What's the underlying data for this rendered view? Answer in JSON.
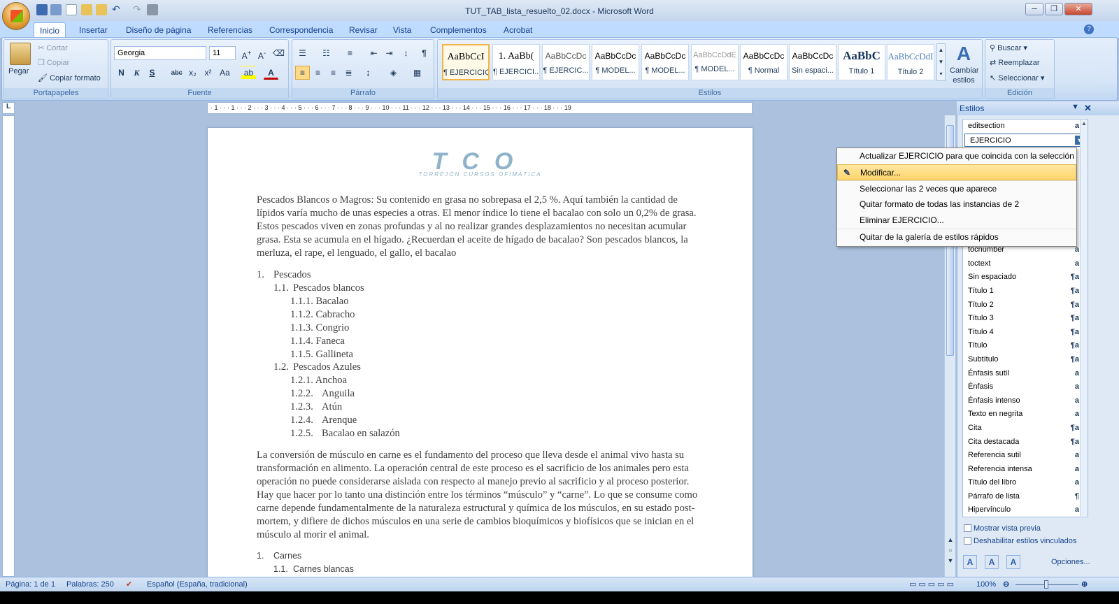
{
  "window": {
    "title": "TUT_TAB_lista_resuelto_02.docx - Microsoft Word",
    "controls": [
      "─",
      "❐",
      "✕"
    ]
  },
  "tabs": [
    "Inicio",
    "Insertar",
    "Diseño de página",
    "Referencias",
    "Correspondencia",
    "Revisar",
    "Vista",
    "Complementos",
    "Acrobat"
  ],
  "ribbon": {
    "portapapeles": {
      "label": "Portapapeles",
      "pegar": "Pegar",
      "cortar": "Cortar",
      "copiar": "Copiar",
      "copiar_formato": "Copiar formato"
    },
    "fuente": {
      "label": "Fuente",
      "font": "Georgia",
      "size": "11"
    },
    "parrafo": {
      "label": "Párrafo"
    },
    "estilos": {
      "label": "Estilos",
      "cambiar": "Cambiar estilos",
      "tiles": [
        {
          "preview": "AaBbCcI",
          "name": "¶ EJERCICIO"
        },
        {
          "preview": "1. AaBb(",
          "name": "¶ EJERCICI..."
        },
        {
          "preview": "AaBbCcDc",
          "name": "¶ EJERCIC..."
        },
        {
          "preview": "AaBbCcDc",
          "name": "¶ MODEL..."
        },
        {
          "preview": "AaBbCcDc",
          "name": "¶ MODEL..."
        },
        {
          "preview": "AaBbCcDdE",
          "name": "¶ MODEL..."
        },
        {
          "preview": "AaBbCcDc",
          "name": "¶ Normal"
        },
        {
          "preview": "AaBbCcDc",
          "name": "Sin espaci..."
        },
        {
          "preview": "AaBbC",
          "name": "Título 1"
        },
        {
          "preview": "AaBbCcDdI",
          "name": "Título 2"
        }
      ]
    },
    "edicion": {
      "label": "Edición",
      "buscar": "Buscar",
      "reemplazar": "Reemplazar",
      "seleccionar": "Seleccionar"
    }
  },
  "document": {
    "logo_big": "TCO",
    "logo_small": "TORREJÓN CURSOS OFIMÁTICA",
    "para1": "Pescados Blancos o Magros: Su contenido en grasa no sobrepasa el 2,5 %. Aquí también la cantidad de lípidos varía mucho de unas especies a otras. El menor índice lo tiene el bacalao con solo un 0,2% de grasa. Estos pescados viven en zonas profundas y al no realizar grandes desplazamientos no necesitan acumular grasa. Esta se acumula en el hígado. ¿Recuerdan el aceite de hígado de bacalao? Son pescados blancos, la merluza, el rape, el lenguado, el gallo, el bacalao",
    "list1": [
      {
        "num": "1.",
        "text": "Pescados"
      },
      {
        "num": "1.1.",
        "text": "Pescados blancos"
      },
      {
        "num": "1.1.1.",
        "text": "Bacalao"
      },
      {
        "num": "1.1.2.",
        "text": "Cabracho"
      },
      {
        "num": "1.1.3.",
        "text": "Congrio"
      },
      {
        "num": "1.1.4.",
        "text": "Faneca"
      },
      {
        "num": "1.1.5.",
        "text": "Gallineta"
      },
      {
        "num": "1.2.",
        "text": "Pescados Azules"
      },
      {
        "num": "1.2.1.",
        "text": "Anchoa"
      },
      {
        "num": "1.2.2.",
        "text": "Anguila"
      },
      {
        "num": "1.2.3.",
        "text": "Atún"
      },
      {
        "num": "1.2.4.",
        "text": "Arenque"
      },
      {
        "num": "1.2.5.",
        "text": "Bacalao en salazón"
      }
    ],
    "para2": "La conversión de músculo en carne es el fundamento del proceso que lleva desde el animal vivo hasta su transformación en alimento. La operación central de este proceso es el sacrificio de los animales pero esta operación no puede considerarse aislada con respecto al manejo previo al sacrificio y al proceso posterior. Hay que hacer por lo tanto una distinción entre los términos “músculo” y “carne”. Lo que se consume como carne depende fundamentalmente de la naturaleza estructural y química de los músculos, en su estado post-mortem, y difiere de dichos músculos en una serie de cambios bioquímicos y biofísicos que se inician en el músculo al morir el animal.",
    "list2": [
      {
        "num": "1.",
        "text": "Carnes"
      },
      {
        "num": "1.1.",
        "text": "Carnes blancas"
      }
    ]
  },
  "styles_pane": {
    "title": "Estilos",
    "items": [
      {
        "name": "editsection",
        "icon": "a"
      },
      {
        "name": "EJERCICIO",
        "icon": "▾"
      },
      {
        "name": "tocnumber",
        "icon": "a"
      },
      {
        "name": "toctext",
        "icon": "a"
      },
      {
        "name": "Sin espaciado",
        "icon": "¶a"
      },
      {
        "name": "Título 1",
        "icon": "¶a"
      },
      {
        "name": "Título 2",
        "icon": "¶a"
      },
      {
        "name": "Título 3",
        "icon": "¶a"
      },
      {
        "name": "Título 4",
        "icon": "¶a"
      },
      {
        "name": "Título",
        "icon": "¶a"
      },
      {
        "name": "Subtítulo",
        "icon": "¶a"
      },
      {
        "name": "Énfasis sutil",
        "icon": "a"
      },
      {
        "name": "Énfasis",
        "icon": "a"
      },
      {
        "name": "Énfasis intenso",
        "icon": "a"
      },
      {
        "name": "Texto en negrita",
        "icon": "a"
      },
      {
        "name": "Cita",
        "icon": "¶a"
      },
      {
        "name": "Cita destacada",
        "icon": "¶a"
      },
      {
        "name": "Referencia sutil",
        "icon": "a"
      },
      {
        "name": "Referencia intensa",
        "icon": "a"
      },
      {
        "name": "Título del libro",
        "icon": "a"
      },
      {
        "name": "Párrafo de lista",
        "icon": "¶"
      },
      {
        "name": "Hipervínculo",
        "icon": "a"
      }
    ],
    "mostrar_vista_previa": "Mostrar vista previa",
    "deshabilitar_vinculados": "Deshabilitar estilos vinculados",
    "opciones": "Opciones..."
  },
  "context_menu": [
    "Actualizar EJERCICIO para que coincida con la selección",
    "Modificar...",
    "Seleccionar las 2 veces que aparece",
    "Quitar formato de todas las instancias de 2",
    "Eliminar EJERCICIO...",
    "Quitar de la galería de estilos rápidos"
  ],
  "status": {
    "pagina": "Página: 1 de 1",
    "palabras": "Palabras: 250",
    "idioma": "Español (España, tradicional)",
    "zoom": "100%"
  },
  "ruler_h": "· 1 · · · 1 · · · 2 · · · 3 · · · 4 · · · 5 · · · 6 · · · 7 · · · 8 · · · 9 · · · 10 · · · 11 · · · 12 · · · 13 · · · 14 · · · 15 · · · 16 · · · 17 · · · 18 · · · 19"
}
